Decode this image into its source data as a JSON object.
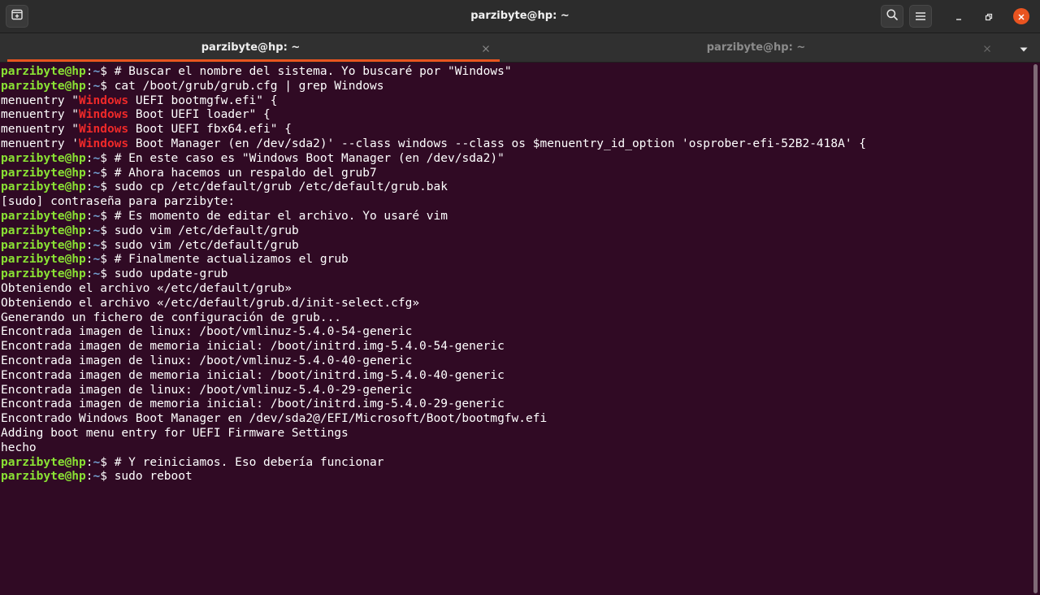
{
  "window": {
    "title": "parzibyte@hp: ~"
  },
  "tabs": [
    {
      "label": "parzibyte@hp: ~",
      "active": true
    },
    {
      "label": "parzibyte@hp: ~",
      "active": false
    }
  ],
  "prompt": {
    "user_host": "parzibyte@hp",
    "separator": ":",
    "path": "~",
    "symbol": "$ "
  },
  "highlight_word": "Windows",
  "terminal": {
    "lines": [
      {
        "type": "cmd",
        "text": "# Buscar el nombre del sistema. Yo buscaré por \"Windows\""
      },
      {
        "type": "cmd",
        "text": "cat /boot/grub/grub.cfg | grep Windows"
      },
      {
        "type": "out",
        "before": "menuentry \"",
        "match": "Windows",
        "after": " UEFI bootmgfw.efi\" {"
      },
      {
        "type": "out",
        "before": "menuentry \"",
        "match": "Windows",
        "after": " Boot UEFI loader\" {"
      },
      {
        "type": "out",
        "before": "menuentry \"",
        "match": "Windows",
        "after": " Boot UEFI fbx64.efi\" {"
      },
      {
        "type": "out",
        "before": "menuentry '",
        "match": "Windows",
        "after": " Boot Manager (en /dev/sda2)' --class windows --class os $menuentry_id_option 'osprober-efi-52B2-418A' {"
      },
      {
        "type": "cmd",
        "text": "# En este caso es \"Windows Boot Manager (en /dev/sda2)\""
      },
      {
        "type": "cmd",
        "text": "# Ahora hacemos un respaldo del grub7"
      },
      {
        "type": "cmd",
        "text": "sudo cp /etc/default/grub /etc/default/grub.bak"
      },
      {
        "type": "out",
        "before": "[sudo] contraseña para parzibyte:"
      },
      {
        "type": "cmd",
        "text": "# Es momento de editar el archivo. Yo usaré vim"
      },
      {
        "type": "cmd",
        "text": "sudo vim /etc/default/grub"
      },
      {
        "type": "cmd",
        "text": "sudo vim /etc/default/grub"
      },
      {
        "type": "cmd",
        "text": "# Finalmente actualizamos el grub"
      },
      {
        "type": "cmd",
        "text": "sudo update-grub"
      },
      {
        "type": "out",
        "before": "Obteniendo el archivo «/etc/default/grub»"
      },
      {
        "type": "out",
        "before": "Obteniendo el archivo «/etc/default/grub.d/init-select.cfg»"
      },
      {
        "type": "out",
        "before": "Generando un fichero de configuración de grub..."
      },
      {
        "type": "out",
        "before": "Encontrada imagen de linux: /boot/vmlinuz-5.4.0-54-generic"
      },
      {
        "type": "out",
        "before": "Encontrada imagen de memoria inicial: /boot/initrd.img-5.4.0-54-generic"
      },
      {
        "type": "out",
        "before": "Encontrada imagen de linux: /boot/vmlinuz-5.4.0-40-generic"
      },
      {
        "type": "out",
        "before": "Encontrada imagen de memoria inicial: /boot/initrd.img-5.4.0-40-generic"
      },
      {
        "type": "out",
        "before": "Encontrada imagen de linux: /boot/vmlinuz-5.4.0-29-generic"
      },
      {
        "type": "out",
        "before": "Encontrada imagen de memoria inicial: /boot/initrd.img-5.4.0-29-generic"
      },
      {
        "type": "out",
        "before": "Encontrado Windows Boot Manager en /dev/sda2@/EFI/Microsoft/Boot/bootmgfw.efi"
      },
      {
        "type": "out",
        "before": "Adding boot menu entry for UEFI Firmware Settings"
      },
      {
        "type": "out",
        "before": "hecho"
      },
      {
        "type": "cmd",
        "text": "# Y reiniciamos. Eso debería funcionar"
      },
      {
        "type": "cmd",
        "text": "sudo reboot"
      }
    ]
  },
  "icons": {
    "new_tab": "new-tab-icon",
    "search": "search-icon",
    "menu": "hamburger-menu-icon",
    "minimize": "minimize-icon",
    "maximize": "maximize-icon",
    "close": "close-icon",
    "tab_close": "close-icon",
    "tab_dropdown": "chevron-down-icon"
  },
  "colors": {
    "terminal_background": "#300a24",
    "prompt_user": "#8ae234",
    "prompt_path": "#729fcf",
    "match_highlight": "#ef2929",
    "accent": "#e95420"
  }
}
